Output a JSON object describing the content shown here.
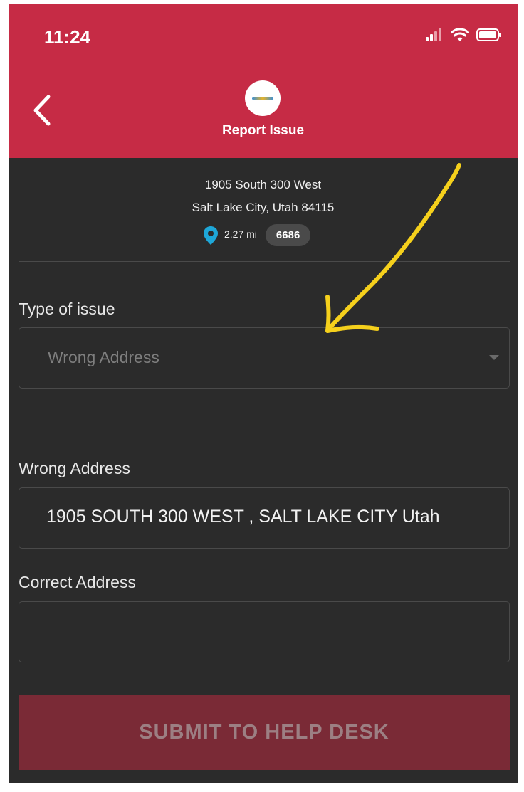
{
  "status_bar": {
    "time": "11:24"
  },
  "header": {
    "title": "Report Issue"
  },
  "location": {
    "address_line1": "1905 South 300 West",
    "address_line2": "Salt Lake City, Utah 84115",
    "distance": "2.27 mi",
    "store_id": "6686"
  },
  "form": {
    "issue_type": {
      "label": "Type of issue",
      "value": "Wrong Address"
    },
    "wrong_address": {
      "label": "Wrong Address",
      "value": "1905 SOUTH 300 WEST , SALT LAKE CITY Utah"
    },
    "correct_address": {
      "label": "Correct Address",
      "value": ""
    },
    "submit_label": "SUBMIT TO HELP DESK"
  },
  "colors": {
    "header": "#c62b45",
    "background": "#2b2b2b",
    "submit_disabled": "#7a2a36",
    "annotation_arrow": "#f5d01c"
  }
}
